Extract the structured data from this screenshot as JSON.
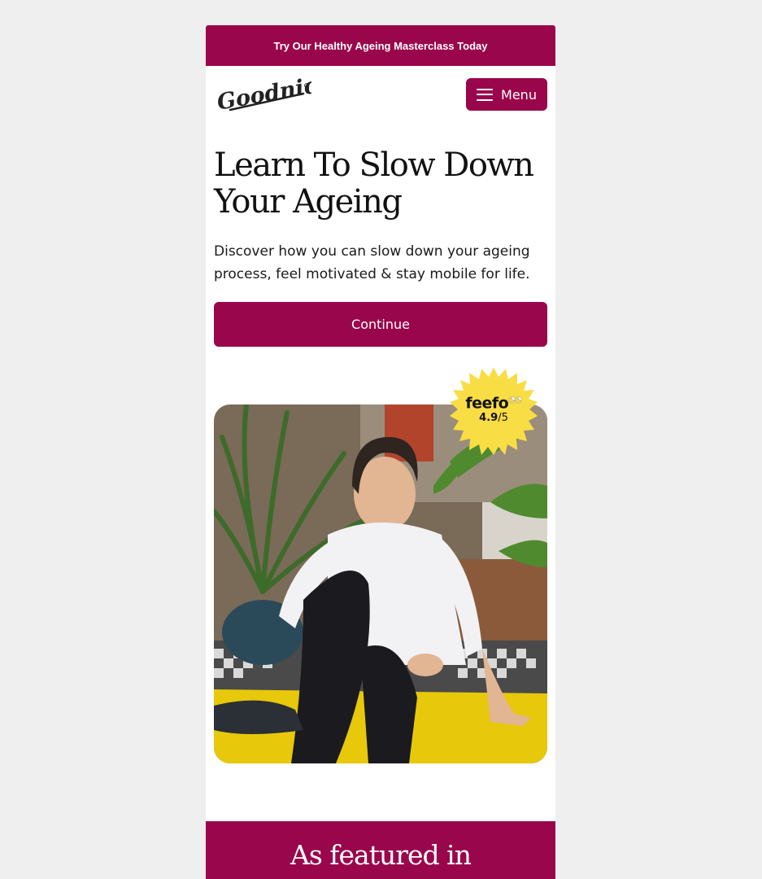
{
  "promo_bar": {
    "text": "Try Our Healthy Ageing Masterclass Today"
  },
  "header": {
    "logo_text": "Goodnick",
    "menu_label": "Menu"
  },
  "hero": {
    "title": "Learn To Slow Down Your Ageing",
    "description": "Discover how you can slow down your ageing process, feel motivated & stay mobile for life.",
    "cta_label": "Continue"
  },
  "rating_badge": {
    "brand": "feefo",
    "score": "4.9",
    "scale": "/5"
  },
  "featured": {
    "title": "As featured in"
  },
  "colors": {
    "brand": "#9a064b",
    "badge": "#f9dd45",
    "mat": "#e7c80a",
    "page_bg": "#efefef"
  },
  "icons": [
    "menu-icon",
    "feefo-logo",
    "goodnick-logo"
  ]
}
